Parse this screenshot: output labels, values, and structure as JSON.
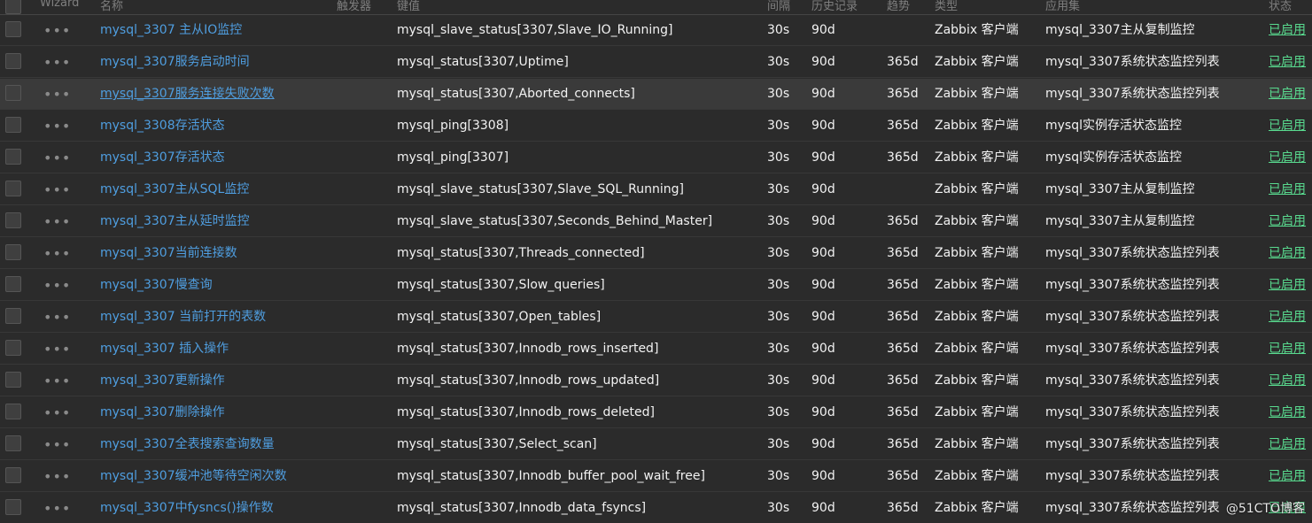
{
  "header": {
    "wizard": "Wizard",
    "name": "名称",
    "triggers": "触发器",
    "key": "键值",
    "interval": "间隔",
    "history": "历史记录",
    "trends": "趋势",
    "type": "类型",
    "applications": "应用集",
    "status": "状态"
  },
  "rows": [
    {
      "name": "mysql_3307 主从IO监控",
      "key": "mysql_slave_status[3307,Slave_IO_Running]",
      "interval": "30s",
      "history": "90d",
      "trends": "",
      "type": "Zabbix 客户端",
      "app": "mysql_3307主从复制监控",
      "status": "已启用"
    },
    {
      "name": "mysql_3307服务启动时间",
      "key": "mysql_status[3307,Uptime]",
      "interval": "30s",
      "history": "90d",
      "trends": "365d",
      "type": "Zabbix 客户端",
      "app": "mysql_3307系统状态监控列表",
      "status": "已启用"
    },
    {
      "name": "mysql_3307服务连接失败次数",
      "key": "mysql_status[3307,Aborted_connects]",
      "interval": "30s",
      "history": "90d",
      "trends": "365d",
      "type": "Zabbix 客户端",
      "app": "mysql_3307系统状态监控列表",
      "status": "已启用"
    },
    {
      "name": "mysql_3308存活状态",
      "key": "mysql_ping[3308]",
      "interval": "30s",
      "history": "90d",
      "trends": "365d",
      "type": "Zabbix 客户端",
      "app": "mysql实例存活状态监控",
      "status": "已启用"
    },
    {
      "name": "mysql_3307存活状态",
      "key": "mysql_ping[3307]",
      "interval": "30s",
      "history": "90d",
      "trends": "365d",
      "type": "Zabbix 客户端",
      "app": "mysql实例存活状态监控",
      "status": "已启用"
    },
    {
      "name": "mysql_3307主从SQL监控",
      "key": "mysql_slave_status[3307,Slave_SQL_Running]",
      "interval": "30s",
      "history": "90d",
      "trends": "",
      "type": "Zabbix 客户端",
      "app": "mysql_3307主从复制监控",
      "status": "已启用"
    },
    {
      "name": "mysql_3307主从延时监控",
      "key": "mysql_slave_status[3307,Seconds_Behind_Master]",
      "interval": "30s",
      "history": "90d",
      "trends": "365d",
      "type": "Zabbix 客户端",
      "app": "mysql_3307主从复制监控",
      "status": "已启用"
    },
    {
      "name": "mysql_3307当前连接数",
      "key": "mysql_status[3307,Threads_connected]",
      "interval": "30s",
      "history": "90d",
      "trends": "365d",
      "type": "Zabbix 客户端",
      "app": "mysql_3307系统状态监控列表",
      "status": "已启用"
    },
    {
      "name": "mysql_3307慢查询",
      "key": "mysql_status[3307,Slow_queries]",
      "interval": "30s",
      "history": "90d",
      "trends": "365d",
      "type": "Zabbix 客户端",
      "app": "mysql_3307系统状态监控列表",
      "status": "已启用"
    },
    {
      "name": "mysql_3307 当前打开的表数",
      "key": "mysql_status[3307,Open_tables]",
      "interval": "30s",
      "history": "90d",
      "trends": "365d",
      "type": "Zabbix 客户端",
      "app": "mysql_3307系统状态监控列表",
      "status": "已启用"
    },
    {
      "name": "mysql_3307 插入操作",
      "key": "mysql_status[3307,Innodb_rows_inserted]",
      "interval": "30s",
      "history": "90d",
      "trends": "365d",
      "type": "Zabbix 客户端",
      "app": "mysql_3307系统状态监控列表",
      "status": "已启用"
    },
    {
      "name": "mysql_3307更新操作",
      "key": "mysql_status[3307,Innodb_rows_updated]",
      "interval": "30s",
      "history": "90d",
      "trends": "365d",
      "type": "Zabbix 客户端",
      "app": "mysql_3307系统状态监控列表",
      "status": "已启用"
    },
    {
      "name": "mysql_3307删除操作",
      "key": "mysql_status[3307,Innodb_rows_deleted]",
      "interval": "30s",
      "history": "90d",
      "trends": "365d",
      "type": "Zabbix 客户端",
      "app": "mysql_3307系统状态监控列表",
      "status": "已启用"
    },
    {
      "name": "mysql_3307全表搜索查询数量",
      "key": "mysql_status[3307,Select_scan]",
      "interval": "30s",
      "history": "90d",
      "trends": "365d",
      "type": "Zabbix 客户端",
      "app": "mysql_3307系统状态监控列表",
      "status": "已启用"
    },
    {
      "name": "mysql_3307缓冲池等待空闲次数",
      "key": "mysql_status[3307,Innodb_buffer_pool_wait_free]",
      "interval": "30s",
      "history": "90d",
      "trends": "365d",
      "type": "Zabbix 客户端",
      "app": "mysql_3307系统状态监控列表",
      "status": "已启用"
    },
    {
      "name": "mysql_3307中fysncs()操作数",
      "key": "mysql_status[3307,Innodb_data_fsyncs]",
      "interval": "30s",
      "history": "90d",
      "trends": "365d",
      "type": "Zabbix 客户端",
      "app": "mysql_3307系统状态监控列表",
      "status": "已启用"
    }
  ],
  "hover_row": 2,
  "watermark": "@51CTO博客",
  "colors": {
    "background": "#2b2b2b",
    "row_hover": "#3a3a3a",
    "link": "#4f9ee0",
    "status_enabled": "#59db8f"
  }
}
